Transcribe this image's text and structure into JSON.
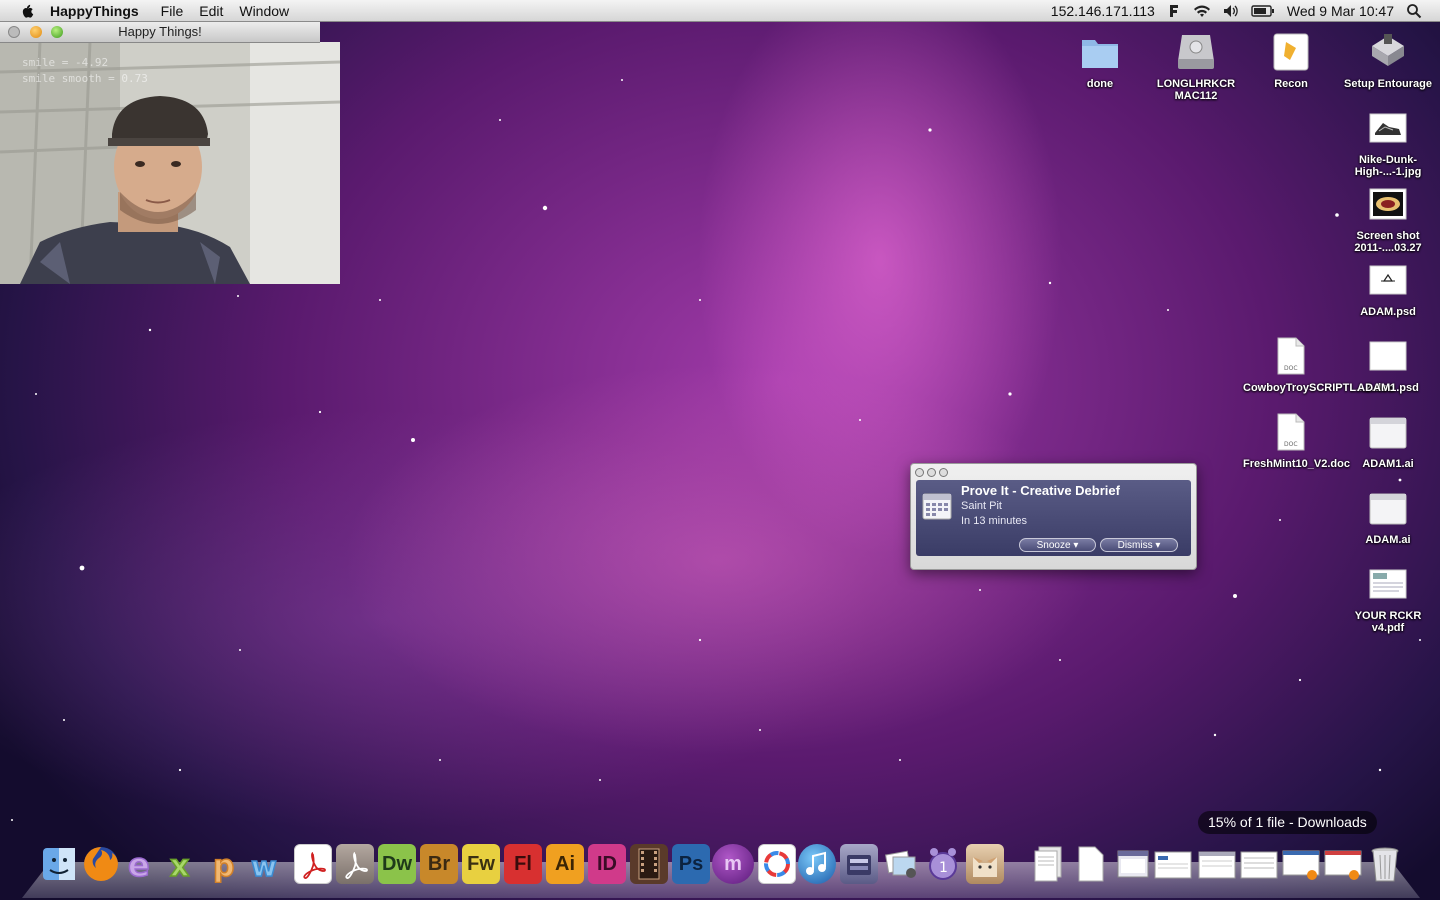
{
  "menubar": {
    "app_name": "HappyThings",
    "menus": [
      "File",
      "Edit",
      "Window"
    ],
    "ip_address": "152.146.171.113",
    "datetime": "Wed 9 Mar  10:47"
  },
  "happy_window": {
    "title": "Happy Things!",
    "smile_line": "smile        = -4.92",
    "smooth_line": "smile smooth = 0.73"
  },
  "desktop_icons": [
    {
      "label": "done"
    },
    {
      "label": "LONGLHRKCR MAC112"
    },
    {
      "label": "Recon"
    },
    {
      "label": "Setup Entourage"
    },
    {
      "label": "Nike-Dunk-High-...-1.jpg"
    },
    {
      "label": "Screen shot 2011-....03.27"
    },
    {
      "label": "ADAM.psd"
    },
    {
      "label": "CowboyTroySCRIPTL...2.doc"
    },
    {
      "label": "ADAM1.psd"
    },
    {
      "label": "FreshMint10_V2.doc"
    },
    {
      "label": "ADAM1.ai"
    },
    {
      "label": "ADAM.ai"
    },
    {
      "label": "YOUR RCKR v4.pdf"
    }
  ],
  "notification": {
    "title": "Prove It - Creative Debrief",
    "location": "Saint Pit",
    "time": "In 13 minutes",
    "snooze_label": "Snooze",
    "dismiss_label": "Dismiss"
  },
  "downloads": {
    "status": "15% of 1 file - Downloads"
  },
  "dock_labels": {
    "dw": "Dw",
    "br": "Br",
    "fw": "Fw",
    "fl": "Fl",
    "ai": "Ai",
    "id": "ID",
    "ps": "Ps",
    "m": "m"
  },
  "colors": {
    "dw": "#1f3a1a",
    "br": "#3b2a12",
    "fw": "#3a3112",
    "fl": "#3a0c0c",
    "ai": "#3b2504",
    "id": "#3a0c26",
    "ps": "#0c2340"
  }
}
